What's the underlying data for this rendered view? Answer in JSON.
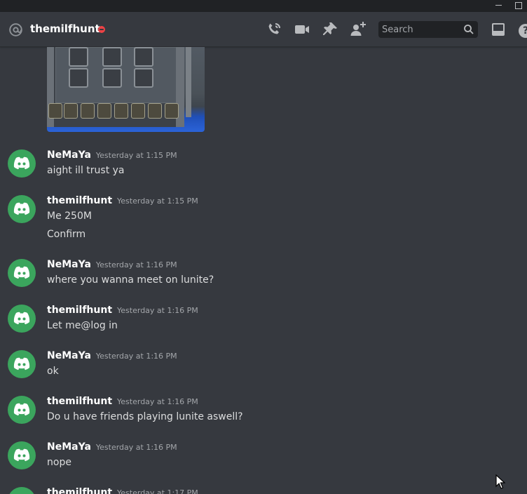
{
  "header": {
    "channel_name": "themilfhunt",
    "search_placeholder": "Search"
  },
  "colors": {
    "background": "#36393f",
    "titlebar": "#202225",
    "avatar": "#3ba55d",
    "dnd_status": "#ed4245"
  },
  "messages": [
    {
      "author": "NeMaYa",
      "time": "Yesterday at 1:15 PM",
      "lines": [
        "aight ill trust ya"
      ]
    },
    {
      "author": "themilfhunt",
      "time": "Yesterday at 1:15 PM",
      "lines": [
        "Me 250M",
        "Confirm"
      ]
    },
    {
      "author": "NeMaYa",
      "time": "Yesterday at 1:16 PM",
      "lines": [
        "where you wanna meet on lunite?"
      ]
    },
    {
      "author": "themilfhunt",
      "time": "Yesterday at 1:16 PM",
      "lines": [
        "Let me@log in"
      ]
    },
    {
      "author": "NeMaYa",
      "time": "Yesterday at 1:16 PM",
      "lines": [
        "ok"
      ]
    },
    {
      "author": "themilfhunt",
      "time": "Yesterday at 1:16 PM",
      "lines": [
        "Do u have friends playing lunite aswell?"
      ]
    },
    {
      "author": "NeMaYa",
      "time": "Yesterday at 1:16 PM",
      "lines": [
        "nope"
      ]
    },
    {
      "author": "themilfhunt",
      "time": "Yesterday at 1:17 PM",
      "lines": []
    }
  ]
}
